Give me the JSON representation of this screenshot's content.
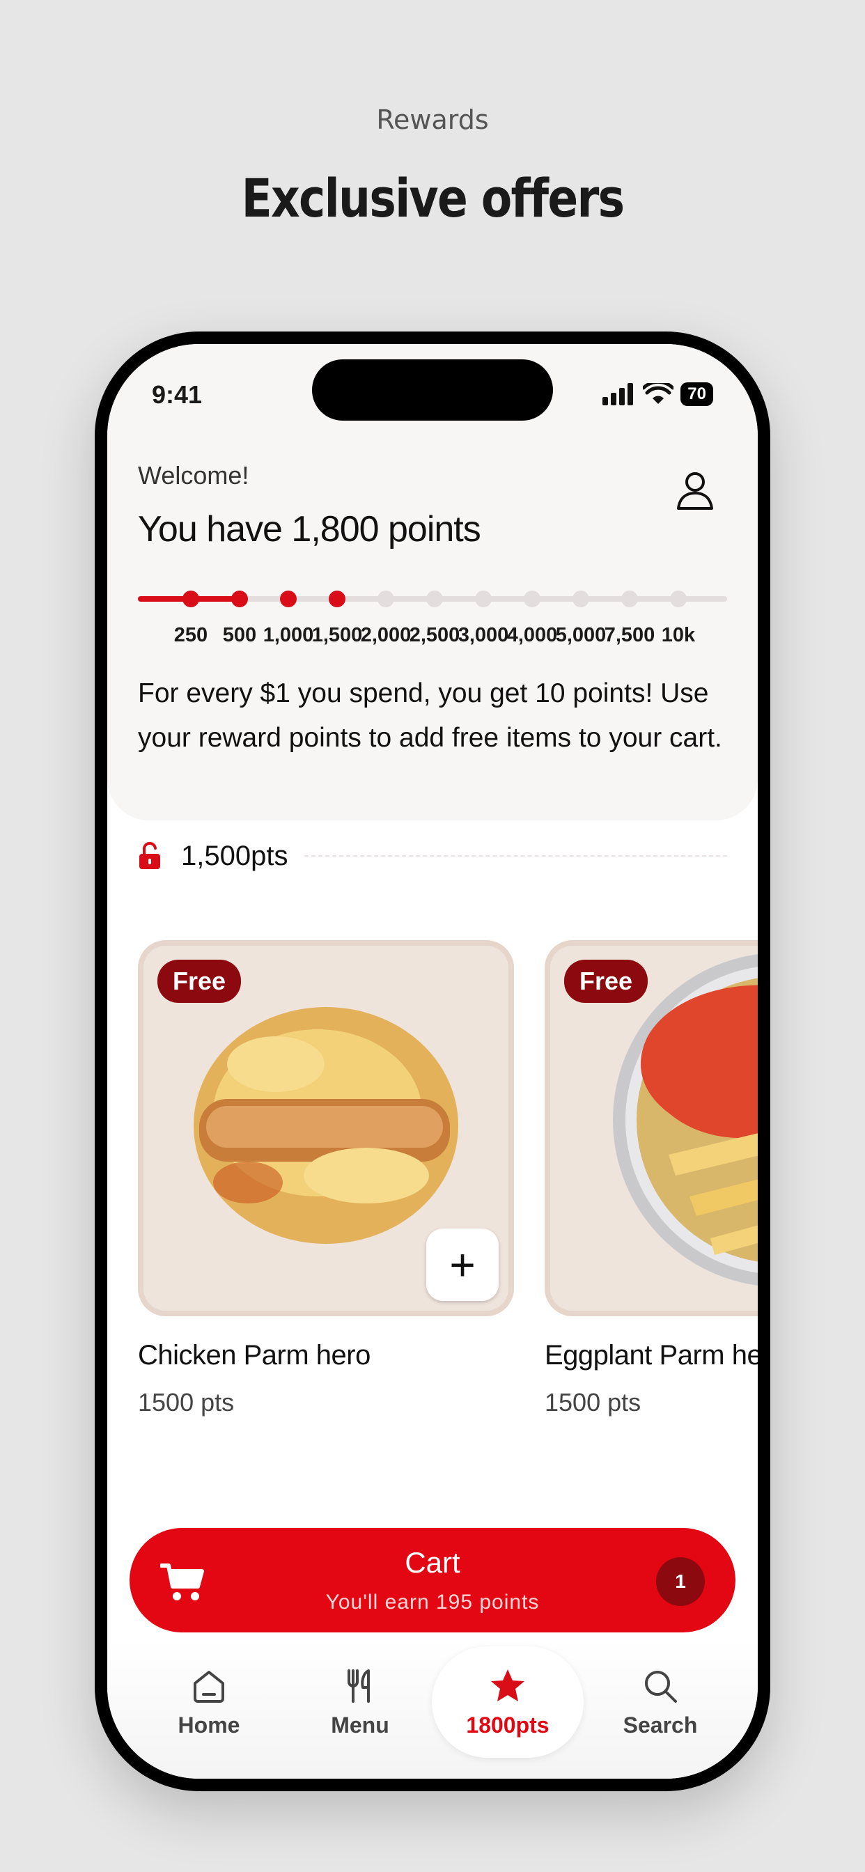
{
  "page": {
    "eyebrow": "Rewards",
    "headline": "Exclusive offers"
  },
  "status_bar": {
    "time": "9:41",
    "battery": "70"
  },
  "header": {
    "welcome": "Welcome!",
    "points_title": "You have 1,800 points",
    "progress": {
      "current_points": 1800,
      "milestones": [
        "250",
        "500",
        "1,000",
        "1,500",
        "2,000",
        "2,500",
        "3,000",
        "4,000",
        "5,000",
        "7,500",
        "10k"
      ],
      "reached_count": 4
    },
    "info_text": "For every $1 you spend, you get 10 points! Use your reward points to add free items to your cart."
  },
  "section": {
    "label": "1,500pts"
  },
  "cards": [
    {
      "badge": "Free",
      "name": "Chicken Parm hero",
      "points": "1500 pts",
      "add_label": "+"
    },
    {
      "badge": "Free",
      "name": "Eggplant Parm hero",
      "points": "1500 pts"
    }
  ],
  "cart": {
    "title": "Cart",
    "subtitle": "You'll earn 195 points",
    "count": "1"
  },
  "nav": {
    "home": "Home",
    "menu": "Menu",
    "rewards": "1800pts",
    "search": "Search"
  },
  "colors": {
    "brand_red": "#e30613",
    "dark_red": "#8c0a0f"
  }
}
